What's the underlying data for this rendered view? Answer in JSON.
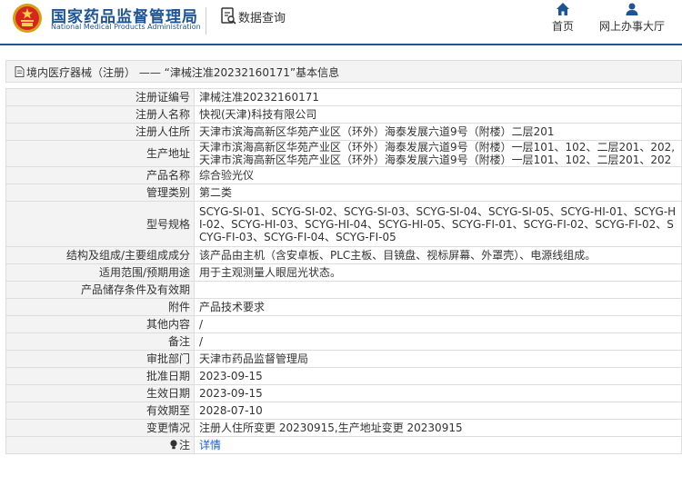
{
  "header": {
    "site_name_cn": "国家药品监督管理局",
    "site_name_en": "National Medical Products Administration",
    "data_query_label": "数据查询",
    "nav_home_label": "首页",
    "nav_office_label": "网上办事大厅",
    "brand_color": "#1e5494"
  },
  "breadcrumb": {
    "category_link": "境内医疗器械（注册）",
    "separator": " —— ",
    "record_title": "“津械注准20232160171”基本信息"
  },
  "details": [
    {
      "label": "注册证编号",
      "value": "津械注准20232160171"
    },
    {
      "label": "注册人名称",
      "value": "快视(天津)科技有限公司"
    },
    {
      "label": "注册人住所",
      "value": "天津市滨海高新区华苑产业区（环外）海泰发展六道9号（附楼）二层201"
    },
    {
      "label": "生产地址",
      "value": "天津市滨海高新区华苑产业区（环外）海泰发展六道9号（附楼）一层101、102、二层201、202,天津市滨海高新区华苑产业区（环外）海泰发展六道9号（附楼）一层101、102、二层201、202"
    },
    {
      "label": "产品名称",
      "value": "综合验光仪"
    },
    {
      "label": "管理类别",
      "value": "第二类"
    },
    {
      "label": "型号规格",
      "value": "SCYG-SI-01、SCYG-SI-02、SCYG-SI-03、SCYG-SI-04、SCYG-SI-05、SCYG-HI-01、SCYG-HI-02、SCYG-HI-03、SCYG-HI-04、SCYG-HI-05、SCYG-FI-01、SCYG-FI-02、SCYG-FI-02、SCYG-FI-03、SCYG-FI-04、SCYG-FI-05"
    },
    {
      "label": "结构及组成/主要组成成分",
      "value": "该产品由主机（含安卓板、PLC主板、目镜盘、视标屏幕、外罩壳）、电源线组成。"
    },
    {
      "label": "适用范围/预期用途",
      "value": "用于主观测量人眼屈光状态。"
    },
    {
      "label": "产品储存条件及有效期",
      "value": ""
    },
    {
      "label": "附件",
      "value": "产品技术要求"
    },
    {
      "label": "其他内容",
      "value": "/"
    },
    {
      "label": "备注",
      "value": "/"
    },
    {
      "label": "审批部门",
      "value": "天津市药品监督管理局"
    },
    {
      "label": "批准日期",
      "value": "2023-09-15"
    },
    {
      "label": "生效日期",
      "value": "2023-09-15"
    },
    {
      "label": "有效期至",
      "value": "2028-07-10"
    },
    {
      "label": "变更情况",
      "value": "注册人住所变更 20230915,生产地址变更 20230915"
    },
    {
      "label": "注",
      "value": "详情",
      "icon": "light-bulb-icon"
    }
  ]
}
